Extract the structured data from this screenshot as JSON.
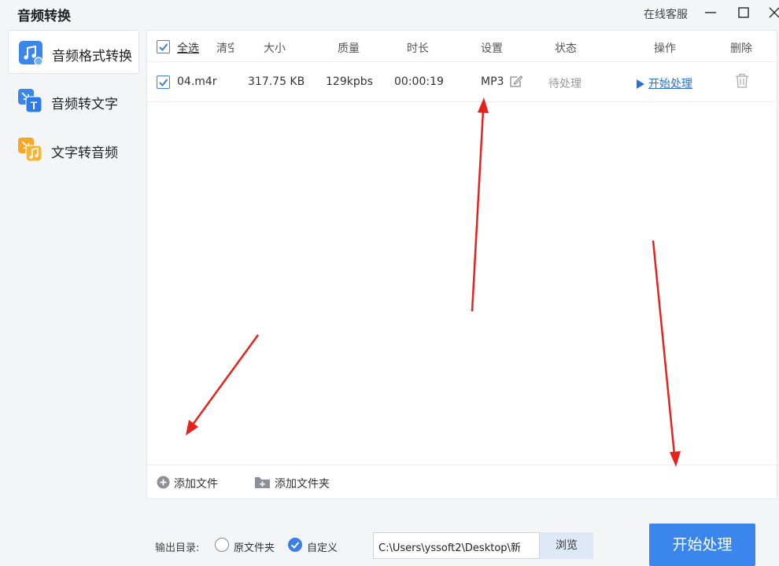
{
  "app": {
    "title": "音频转换",
    "support_label": "在线客服"
  },
  "sidebar": {
    "items": [
      {
        "label": "音频格式转换",
        "icon": "music-note-icon",
        "active": true
      },
      {
        "label": "音频转文字",
        "icon": "audio-to-text-icon",
        "active": false
      },
      {
        "label": "文字转音频",
        "icon": "text-to-audio-icon",
        "active": false
      }
    ]
  },
  "table": {
    "headers": {
      "select_all": "全选",
      "clear": "清空",
      "size": "大小",
      "quality": "质量",
      "duration": "时长",
      "settings": "设置",
      "status": "状态",
      "action": "操作",
      "delete": "删除"
    },
    "rows": [
      {
        "checked": true,
        "name": "04.m4r",
        "size": "317.75 KB",
        "quality": "129kpbs",
        "duration": "00:00:19",
        "format": "MP3",
        "status": "待处理",
        "action": "开始处理"
      }
    ]
  },
  "footer": {
    "add_file": "添加文件",
    "add_folder": "添加文件夹"
  },
  "output": {
    "label": "输出目录:",
    "option_original": "原文件夹",
    "option_custom": "自定义",
    "selected": "自定义",
    "path": "C:\\Users\\yssoft2\\Desktop\\新",
    "browse": "浏览"
  },
  "start_button": "开始处理",
  "colors": {
    "accent": "#3a86ec",
    "annotation_arrow": "#e8221b",
    "link": "#2a6fd8"
  }
}
